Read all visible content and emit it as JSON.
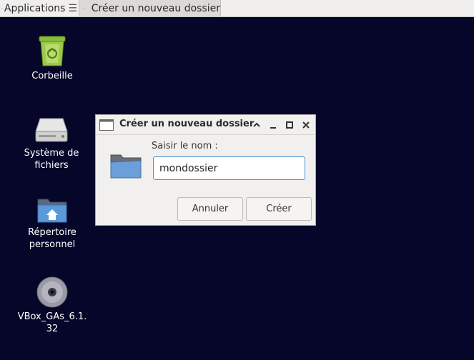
{
  "panel": {
    "app_menu_label": "Applications",
    "task_title": "Créer un nouveau dossier"
  },
  "desktop": {
    "icons": [
      {
        "label": "Corbeille",
        "icon": "trash-icon"
      },
      {
        "label": "Système de fichiers",
        "icon": "drive-icon"
      },
      {
        "label": "Répertoire personnel",
        "icon": "home-folder-icon"
      },
      {
        "label": "VBox_GAs_6.1.32",
        "icon": "optical-disc-icon"
      }
    ]
  },
  "dialog": {
    "title": "Créer un nouveau dossier",
    "prompt": "Saisir le nom :",
    "input_value": "mondossier",
    "cancel_label": "Annuler",
    "create_label": "Créer"
  },
  "colors": {
    "desktop_bg": "#06062a",
    "focus_accent": "#4a90d9"
  }
}
